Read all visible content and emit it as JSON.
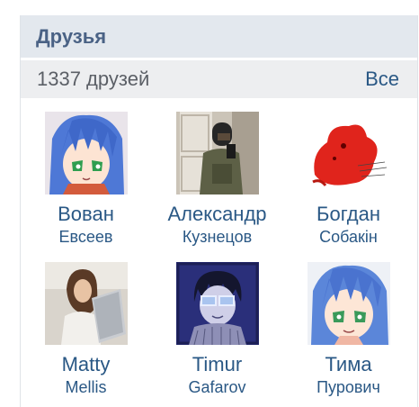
{
  "header": {
    "title": "Друзья"
  },
  "subheader": {
    "count_text": "1337 друзей",
    "all_label": "Все"
  },
  "friends": [
    {
      "first_name": "Вован",
      "last_name": "Евсеев",
      "avatar": "anime-blue-hair-avatar"
    },
    {
      "first_name": "Александр",
      "last_name": "Кузнецов",
      "avatar": "mirror-selfie-soldier-avatar"
    },
    {
      "first_name": "Богдан",
      "last_name": "Собакін",
      "avatar": "red-blob-drawing-avatar"
    },
    {
      "first_name": "Matty",
      "last_name": "Mellis",
      "avatar": "girl-with-laptop-avatar"
    },
    {
      "first_name": "Timur",
      "last_name": "Gafarov",
      "avatar": "drawn-boy-glasses-avatar"
    },
    {
      "first_name": "Тима",
      "last_name": "Пурович",
      "avatar": "anime-blue-hair-avatar"
    }
  ],
  "colors": {
    "header_bg": "#e3e8ee",
    "header_text": "#4a6285",
    "subheader_bg": "#edeef0",
    "link": "#2a5885",
    "muted_text": "#5b5f66"
  }
}
